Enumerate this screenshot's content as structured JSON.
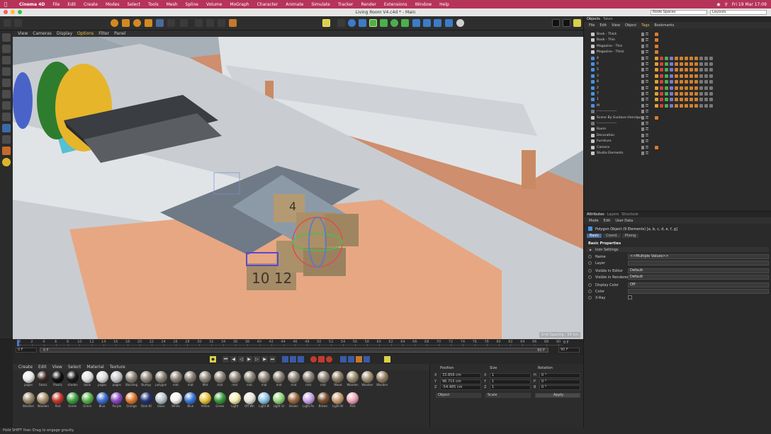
{
  "menubar": {
    "app": "Cinema 4D",
    "items": [
      "File",
      "Edit",
      "Create",
      "Modes",
      "Select",
      "Tools",
      "Mesh",
      "Spline",
      "Volume",
      "MoGraph",
      "Character",
      "Animate",
      "Simulate",
      "Tracker",
      "Render",
      "Extensions",
      "Window",
      "Help"
    ],
    "clock": "Fri 19 Mar 17:09"
  },
  "window": {
    "title": "Living Room V4.c4d * - Main",
    "node_spaces": "Node Spaces",
    "layouts": "Layouts"
  },
  "viewport": {
    "menu": [
      "View",
      "Cameras",
      "Display",
      "Options",
      "Filter",
      "Panel"
    ],
    "active_menu": "Options",
    "corner_label": "Perspective",
    "footer": "Grid Spacing : 50 cm"
  },
  "timeline": {
    "ticks": [
      "0",
      "2",
      "4",
      "6",
      "8",
      "10",
      "12",
      "14",
      "16",
      "18",
      "20",
      "22",
      "24",
      "26",
      "28",
      "30",
      "32",
      "34",
      "36",
      "38",
      "40",
      "42",
      "44",
      "46",
      "48",
      "50",
      "52",
      "54",
      "56",
      "58",
      "60",
      "62",
      "64",
      "66",
      "68",
      "70",
      "72",
      "74",
      "76",
      "78",
      "80",
      "82",
      "84",
      "86",
      "88",
      "90"
    ],
    "current_frame": "0 F",
    "start_field": "0 F",
    "inner_start": "0 F",
    "inner_end": "90 F",
    "end_field": "90 F",
    "end_label": "0 F"
  },
  "materials": {
    "menu": [
      "Create",
      "Edit",
      "View",
      "Select",
      "Material",
      "Texture"
    ],
    "row1": [
      {
        "label": "pages",
        "color": "#e8e8e8"
      },
      {
        "label": "Fabric",
        "color": "#3a2a26"
      },
      {
        "label": "Plastic",
        "color": "#111111"
      },
      {
        "label": "shades",
        "color": "#1a1a1a"
      },
      {
        "label": "book",
        "color": "#e0e0e0"
      },
      {
        "label": "pages",
        "color": "#dcdcdc"
      },
      {
        "label": "pages",
        "color": "#c8c8c8"
      },
      {
        "label": "Blocking",
        "color": "#8a8275"
      },
      {
        "label": "Bumpy",
        "color": "#8c8477"
      },
      {
        "label": "polygon",
        "color": "#867e72"
      },
      {
        "label": "mat",
        "color": "#89827a"
      },
      {
        "label": "mat",
        "color": "#857d71"
      },
      {
        "label": "Mat",
        "color": "#8b8377"
      },
      {
        "label": "mat",
        "color": "#878073"
      },
      {
        "label": "mat",
        "color": "#8a8276"
      },
      {
        "label": "mat",
        "color": "#868073"
      },
      {
        "label": "mat",
        "color": "#8a8276"
      },
      {
        "label": "mat",
        "color": "#857e72"
      },
      {
        "label": "mat",
        "color": "#8a8275"
      },
      {
        "label": "mat",
        "color": "#878073"
      },
      {
        "label": "mat",
        "color": "#8a8276"
      },
      {
        "label": "Wood",
        "color": "#8b7b62"
      },
      {
        "label": "Wooden",
        "color": "#9a8b6e"
      },
      {
        "label": "Wooden",
        "color": "#a08e6f"
      },
      {
        "label": "Wooden",
        "color": "#977f63"
      }
    ],
    "row2": [
      {
        "label": "Wooden",
        "color": "#9c8a6b"
      },
      {
        "label": "Wooden",
        "color": "#a8926f"
      },
      {
        "label": "Red",
        "color": "#c23a2e"
      },
      {
        "label": "Green",
        "color": "#3fa143"
      },
      {
        "label": "Green",
        "color": "#58b44c"
      },
      {
        "label": "Blue",
        "color": "#3f6fcf"
      },
      {
        "label": "Purple",
        "color": "#8a4ac2"
      },
      {
        "label": "Orange",
        "color": "#e07b2e"
      },
      {
        "label": "Dark Bl",
        "color": "#24367a"
      },
      {
        "label": "Glass",
        "color": "#b9c6cc"
      },
      {
        "label": "White",
        "color": "#f2f2f2"
      },
      {
        "label": "Blue",
        "color": "#3b78d8"
      },
      {
        "label": "Yellow",
        "color": "#e8c63a"
      },
      {
        "label": "Green",
        "color": "#3c9a3e"
      },
      {
        "label": "Light",
        "color": "#f4eeb0"
      },
      {
        "label": "Off Wh",
        "color": "#e9e5da"
      },
      {
        "label": "Light Bl",
        "color": "#8fc4e6"
      },
      {
        "label": "Light Gr",
        "color": "#94d67e"
      },
      {
        "label": "Brown",
        "color": "#9b6a43"
      },
      {
        "label": "Light Pu",
        "color": "#c9a6e6"
      },
      {
        "label": "Brown",
        "color": "#7c5030"
      },
      {
        "label": "Light Br",
        "color": "#c79d74"
      },
      {
        "label": "Pink",
        "color": "#f0a5b8"
      }
    ]
  },
  "coordinates": {
    "headers": [
      "Position",
      "Size",
      "Rotation"
    ],
    "rows": [
      {
        "axis": "X",
        "pos": "33.856 cm",
        "size_axis": "X",
        "size": "1",
        "rot_axis": "H",
        "rot": "0 °"
      },
      {
        "axis": "Y",
        "pos": "96.715 cm",
        "size_axis": "Y",
        "size": "1",
        "rot_axis": "P",
        "rot": "0 °"
      },
      {
        "axis": "Z",
        "pos": "-54.485 cm",
        "size_axis": "Z",
        "size": "1",
        "rot_axis": "B",
        "rot": "0 °"
      }
    ],
    "mode1": "Object",
    "mode2": "Scale",
    "apply": "Apply"
  },
  "objects": {
    "tabs": [
      "Objects",
      "Takes"
    ],
    "menu": [
      "File",
      "Edit",
      "View",
      "Object",
      "Tags",
      "Bookmarks"
    ],
    "active_menu": "Tags",
    "rows": [
      {
        "name": "Book - Thick",
        "color": "#c8c8c8",
        "tags": 1
      },
      {
        "name": "Book - Thin",
        "color": "#c8c8c8",
        "tags": 1
      },
      {
        "name": "Magazine - Thin",
        "color": "#c8c8c8",
        "tags": 1
      },
      {
        "name": "Magazine - Thick",
        "color": "#c8c8c8",
        "tags": 1
      },
      {
        "name": "4",
        "color": "#4a90e2",
        "tags": 12
      },
      {
        "name": "6",
        "color": "#4a90e2",
        "tags": 12
      },
      {
        "name": "5",
        "color": "#4a90e2",
        "tags": 12
      },
      {
        "name": "3",
        "color": "#4a90e2",
        "tags": 12
      },
      {
        "name": "8",
        "color": "#4a90e2",
        "tags": 12
      },
      {
        "name": "2",
        "color": "#4a90e2",
        "tags": 12
      },
      {
        "name": "7",
        "color": "#4a90e2",
        "tags": 12
      },
      {
        "name": "1",
        "color": "#4a90e2",
        "tags": 12
      },
      {
        "name": "M",
        "color": "#4a90e2",
        "tags": 12
      },
      {
        "name": "-----------------",
        "color": "#777777",
        "tags": 0
      },
      {
        "name": "Scene By Gustavo Henrique",
        "color": "#c8c8c8",
        "tags": 1
      },
      {
        "name": "-----------------",
        "color": "#777777",
        "tags": 0
      },
      {
        "name": "Room",
        "color": "#c8c8c8",
        "tags": 0
      },
      {
        "name": "Decoration",
        "color": "#c8c8c8",
        "tags": 0
      },
      {
        "name": "Furniture",
        "color": "#c8c8c8",
        "tags": 0
      },
      {
        "name": "Camera",
        "color": "#c8c8c8",
        "tags": 1
      },
      {
        "name": "Studio Elements",
        "color": "#c8c8c8",
        "tags": 0
      }
    ]
  },
  "attributes": {
    "tabs": [
      "Attributes",
      "Layers",
      "Structure"
    ],
    "menu": [
      "Mode",
      "Edit",
      "User Data"
    ],
    "object_label": "Polygon Object (9 Elements) [a, b, c, d, e, f, g]",
    "subtabs": [
      "Basic",
      "Coord.",
      "Phong"
    ],
    "section": "Basic Properties",
    "subsection": "Icon Settings",
    "fields": [
      {
        "label": "Name",
        "value": "<<Multiple Values>>"
      },
      {
        "label": "Layer",
        "value": ""
      },
      {
        "label": "Visible in Editor",
        "value": "Default"
      },
      {
        "label": "Visible in Renderer",
        "value": "Default"
      },
      {
        "label": "Display Color",
        "value": "Off"
      },
      {
        "label": "Color",
        "value": ""
      },
      {
        "label": "X-Ray",
        "value": ""
      }
    ]
  },
  "status": "Hold SHIFT then Drag to engage gravity."
}
